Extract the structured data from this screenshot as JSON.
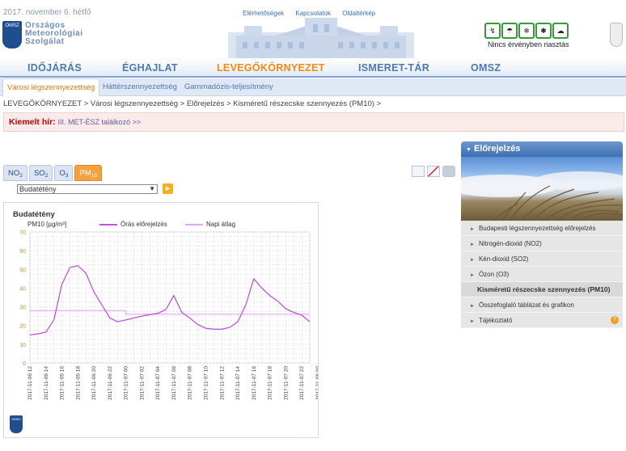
{
  "header": {
    "date": "2017. november 6. hétfő",
    "logo_badge": "OMSZ",
    "logo_lines": [
      "Országos",
      "Meteorológiai",
      "Szolgálat"
    ],
    "top_links": [
      "Elérhetőségek",
      "Kapcsolatok",
      "Oldaltérkép"
    ],
    "warning_icons": [
      "wind-warning-icon",
      "rain-warning-icon",
      "snow-warning-icon",
      "frost-warning-icon",
      "thunderstorm-warning-icon"
    ],
    "warning_text": "Nincs érvényben riasztás"
  },
  "nav": {
    "items": [
      "IDŐJÁRÁS",
      "ÉGHAJLAT",
      "LEVEGŐKÖRNYEZET",
      "ISMERET-TÁR",
      "OMSZ"
    ],
    "active": "LEVEGŐKÖRNYEZET"
  },
  "subnav": {
    "items": [
      "Városi légszennyezettség",
      "Háttérszennyezettség",
      "Gammadózis-teljesítmény"
    ],
    "active": "Városi légszennyezettség"
  },
  "breadcrumb": "LEVEGŐKÖRNYEZET > Városi légszennyezettség > Előrejelzés > Kisméretű részecske szennyezés (PM10) >",
  "highlight": {
    "label": "Kiemelt hír:",
    "link": "III. MET-ÉSZ találkozó >>"
  },
  "pollutant_tabs": [
    "NO2",
    "SO2",
    "O3",
    "PM10"
  ],
  "active_pollutant": "PM10",
  "station_select": {
    "value": "Budatétény"
  },
  "chart_data": {
    "type": "line",
    "title": "Budatétény",
    "ylabel": "PM10 [µg/m³]",
    "ylim": [
      0,
      70
    ],
    "yticks": [
      0,
      10,
      20,
      30,
      40,
      50,
      60,
      70
    ],
    "grid": true,
    "legend_position": "top",
    "x": [
      "2017-11-06 12",
      "2017-11-06 14",
      "2017-11-06 16",
      "2017-11-06 18",
      "2017-11-06 20",
      "2017-11-06 22",
      "2017-11-07 00",
      "2017-11-07 02",
      "2017-11-07 04",
      "2017-11-07 06",
      "2017-11-07 08",
      "2017-11-07 10",
      "2017-11-07 12",
      "2017-11-07 14",
      "2017-11-07 16",
      "2017-11-07 18",
      "2017-11-07 20",
      "2017-11-07 22",
      "2017-11-08 00"
    ],
    "series": [
      {
        "name": "Órás előrejelzés",
        "color": "#c155d8",
        "points": [
          [
            0,
            15
          ],
          [
            1,
            15.5
          ],
          [
            2,
            16.5
          ],
          [
            3,
            23
          ],
          [
            4,
            42
          ],
          [
            5,
            51
          ],
          [
            6,
            52
          ],
          [
            7,
            48
          ],
          [
            8,
            38
          ],
          [
            9,
            31
          ],
          [
            10,
            24
          ],
          [
            11,
            22
          ],
          [
            12,
            23
          ],
          [
            13,
            24
          ],
          [
            14,
            25
          ],
          [
            15,
            25.8
          ],
          [
            16,
            26.5
          ],
          [
            17,
            28.5
          ],
          [
            18,
            36
          ],
          [
            19,
            27
          ],
          [
            20,
            24
          ],
          [
            21,
            20.5
          ],
          [
            22,
            18.5
          ],
          [
            23,
            18
          ],
          [
            24,
            18
          ],
          [
            25,
            19
          ],
          [
            26,
            22
          ],
          [
            27,
            31
          ],
          [
            28,
            45
          ],
          [
            29,
            40
          ],
          [
            30,
            36
          ],
          [
            31,
            33
          ],
          [
            32,
            29
          ],
          [
            33,
            27
          ],
          [
            34,
            25.5
          ],
          [
            35,
            22
          ]
        ]
      },
      {
        "name": "Napi átlag",
        "color": "#e2a9f0",
        "points": [
          [
            0,
            28
          ],
          [
            12,
            28
          ],
          [
            12,
            26
          ],
          [
            35,
            26
          ]
        ]
      }
    ]
  },
  "right_panel": {
    "title": "Előrejelzés",
    "items": [
      "Budapesti légszennyezettség előrejelzés",
      "Nitrogén-dioxid (NO2)",
      "Kén-dioxid (SO2)",
      "Ózon (O3)",
      "Kisméretű részecske szennyezés (PM10)",
      "Összefoglaló táblázat és grafikon",
      "Tájékoztató"
    ],
    "active_item": "Kisméretű részecske szennyezés (PM10)",
    "help_icon": "?"
  }
}
